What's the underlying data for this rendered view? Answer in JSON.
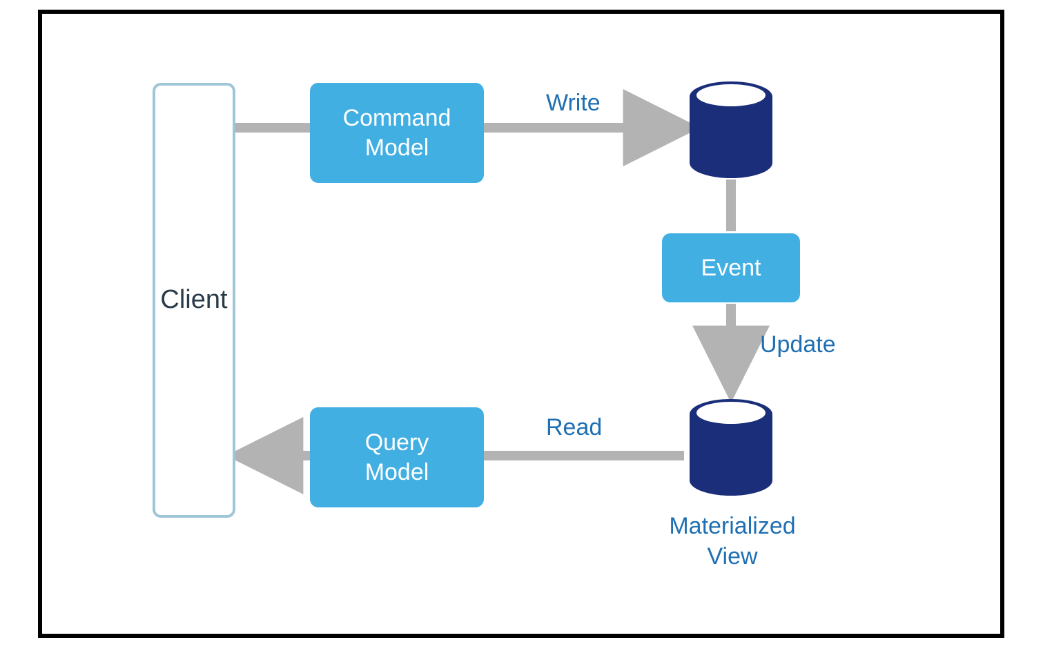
{
  "nodes": {
    "client": "Client",
    "command_model": "Command\nModel",
    "query_model": "Query\nModel",
    "event": "Event",
    "materialized_view": "Materialized\nView"
  },
  "edges": {
    "write": "Write",
    "read": "Read",
    "update": "Update"
  }
}
